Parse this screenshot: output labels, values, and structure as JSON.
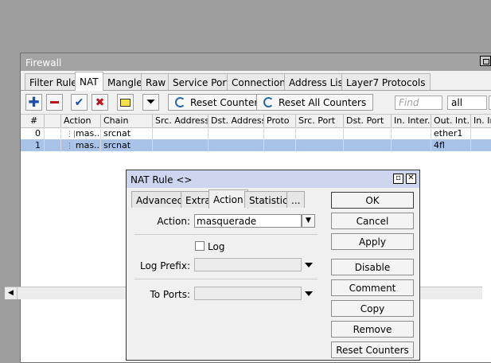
{
  "firewall": {
    "title": "Firewall",
    "tabs": [
      "Filter Rules",
      "NAT",
      "Mangle",
      "Raw",
      "Service Ports",
      "Connections",
      "Address Lists",
      "Layer7 Protocols"
    ],
    "active_tab": "NAT",
    "toolbar": {
      "reset_counters": "Reset Counters",
      "reset_all_counters": "Reset All Counters",
      "find_placeholder": "Find",
      "filter_value": "all"
    },
    "columns": [
      "#",
      "Action",
      "Chain",
      "Src. Address",
      "Dst. Address",
      "Proto",
      "Src. Port",
      "Dst. Port",
      "In. Inter...",
      "Out. Int...",
      "In. In"
    ],
    "rows": [
      {
        "num": "0",
        "action": "mas...",
        "chain": "srcnat",
        "out_int": "ether1",
        "selected": false
      },
      {
        "num": "1",
        "action": "mas...",
        "chain": "srcnat",
        "out_int": "4fl",
        "selected": true
      }
    ],
    "scroll_left_icon": "◀"
  },
  "dialog": {
    "title": "NAT Rule <>",
    "tabs": [
      "Advanced",
      "Extra",
      "Action",
      "Statistics",
      "..."
    ],
    "active_tab": "Action",
    "action_label": "Action:",
    "action_value": "masquerade",
    "log_label": "Log",
    "log_prefix_label": "Log Prefix:",
    "to_ports_label": "To Ports:",
    "buttons": [
      "OK",
      "Cancel",
      "Apply",
      "Disable",
      "Comment",
      "Copy",
      "Remove",
      "Reset Counters"
    ]
  },
  "colors": {
    "background": "#9e9e9e",
    "selected_row": "#a8c2e8",
    "dialog_title": "#cdd6ee",
    "add_icon": "#1a4fb0",
    "remove_icon": "#c0141b"
  }
}
